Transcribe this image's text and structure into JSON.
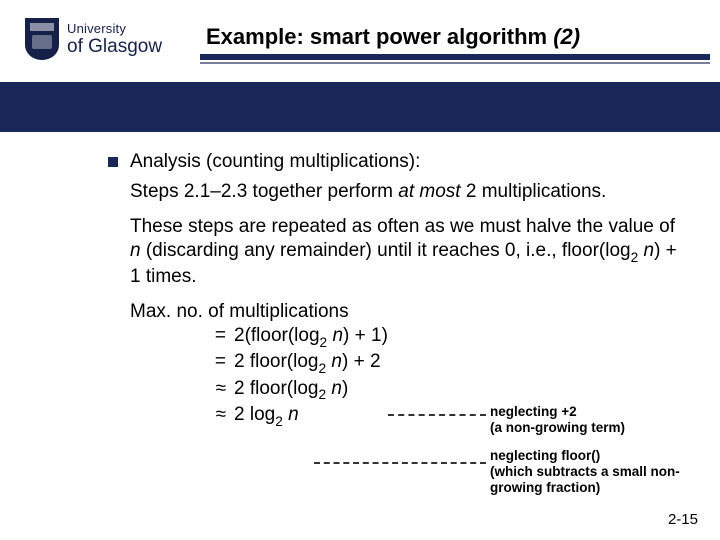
{
  "logo": {
    "small": "University",
    "big": "of Glasgow"
  },
  "title": {
    "prefix": "Example: smart power algorithm ",
    "suffix": "(2)"
  },
  "bullet": "Analysis (counting multiplications):",
  "p1a": "Steps 2.1–2.3 together perform ",
  "p1b": "at most",
  "p1c": " 2 multiplications.",
  "p2a": "These steps are repeated as often as we must halve the value of ",
  "p2b": "n",
  "p2c": " (discarding any remainder) until it reaches 0, i.e., floor(log",
  "p2d": "2",
  "p2e": " ",
  "p2f": "n",
  "p2g": ") + 1 times.",
  "eq_head": "Max. no. of multiplications",
  "eq": {
    "l1": {
      "sym": "=",
      "a": "2(floor(log",
      "sub": "2",
      "b": " ",
      "n": "n",
      "c": ") + 1)"
    },
    "l2": {
      "sym": "=",
      "a": "2 floor(log",
      "sub": "2",
      "b": " ",
      "n": "n",
      "c": ") + 2"
    },
    "l3": {
      "sym": "≈",
      "a": "2 floor(log",
      "sub": "2",
      "b": " ",
      "n": "n",
      "c": ")"
    },
    "l4": {
      "sym": "≈",
      "a": "2 log",
      "sub": "2",
      "b": " ",
      "n": "n",
      "c": ""
    }
  },
  "note1a": "neglecting +2",
  "note1b": "(a non-growing term)",
  "note2a": "neglecting floor()",
  "note2b": "(which subtracts a small non-growing fraction)",
  "footer": "2-15"
}
